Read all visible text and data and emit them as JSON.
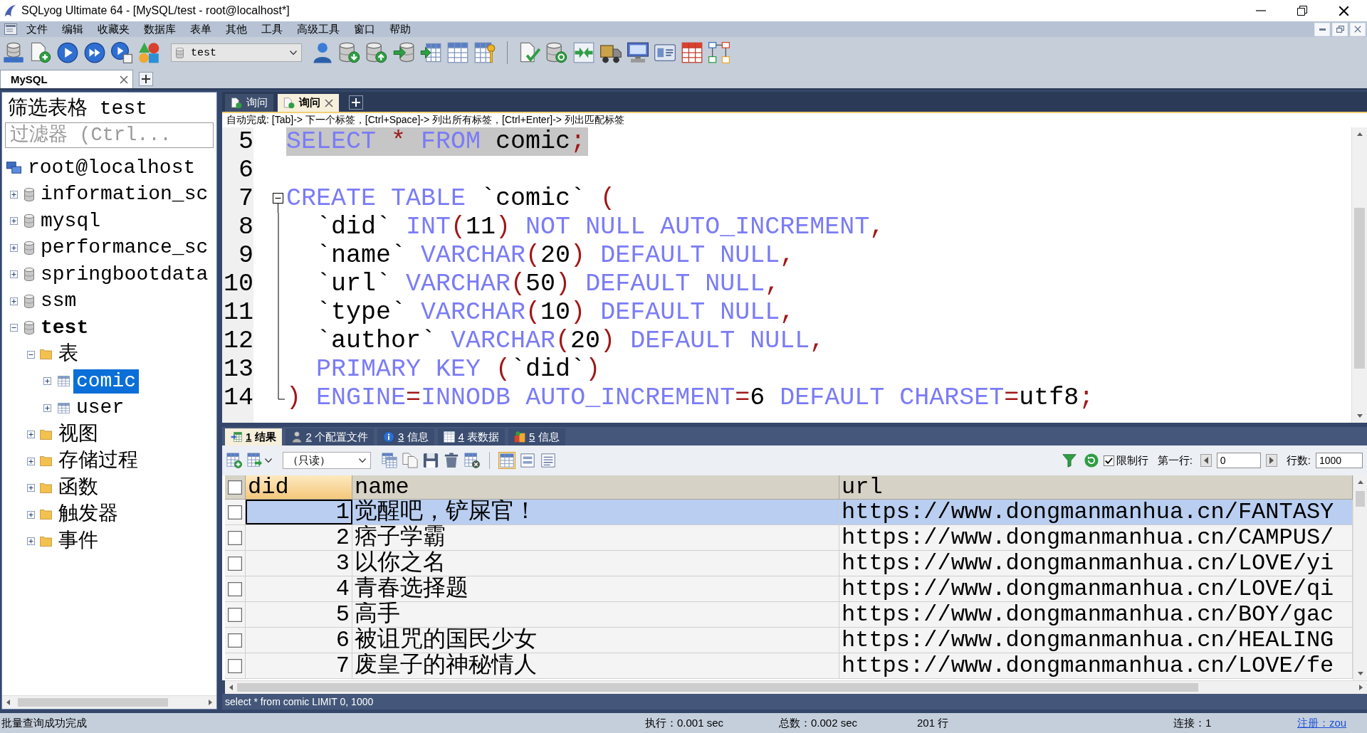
{
  "window": {
    "title": "SQLyog Ultimate 64 - [MySQL/test - root@localhost*]"
  },
  "menu": [
    "文件",
    "编辑",
    "收藏夹",
    "数据库",
    "表单",
    "其他",
    "工具",
    "高级工具",
    "窗口",
    "帮助"
  ],
  "toolbar": {
    "database": "test"
  },
  "connection_tabs": [
    {
      "label": "MySQL",
      "selected": true
    }
  ],
  "object_browser": {
    "title": "筛选表格 test",
    "filter": {
      "placeholder": "过滤器 (Ctrl..."
    },
    "tree": {
      "label": "root@localhost",
      "kind": "server",
      "selected": false,
      "children": [
        {
          "label": "information_sc",
          "kind": "database",
          "expanded": false,
          "current": false,
          "selected": false
        },
        {
          "label": "mysql",
          "kind": "database",
          "expanded": false,
          "current": false,
          "selected": false
        },
        {
          "label": "performance_sc",
          "kind": "database",
          "expanded": false,
          "current": false,
          "selected": false
        },
        {
          "label": "springbootdata",
          "kind": "database",
          "expanded": false,
          "current": false,
          "selected": false
        },
        {
          "label": "ssm",
          "kind": "database",
          "expanded": false,
          "current": false,
          "selected": false
        },
        {
          "label": "test",
          "kind": "database",
          "expanded": true,
          "current": true,
          "selected": false,
          "children": [
            {
              "label": "表",
              "kind": "folder",
              "expanded": true,
              "selected": false,
              "children": [
                {
                  "label": "comic",
                  "kind": "table",
                  "expanded": false,
                  "selected": true
                },
                {
                  "label": "user",
                  "kind": "table",
                  "expanded": false,
                  "selected": false
                }
              ]
            },
            {
              "label": "视图",
              "kind": "folder",
              "expanded": false,
              "selected": false
            },
            {
              "label": "存储过程",
              "kind": "folder",
              "expanded": false,
              "selected": false
            },
            {
              "label": "函数",
              "kind": "folder",
              "expanded": false,
              "selected": false
            },
            {
              "label": "触发器",
              "kind": "folder",
              "expanded": false,
              "selected": false
            },
            {
              "label": "事件",
              "kind": "folder",
              "expanded": false,
              "selected": false
            }
          ]
        }
      ]
    }
  },
  "query_tabs": [
    {
      "label": "询问",
      "selected": false
    },
    {
      "label": "询问",
      "selected": true
    }
  ],
  "autocomplete_hint": "自动完成: [Tab]-> 下一个标签，[Ctrl+Space]-> 列出所有标签，[Ctrl+Enter]-> 列出匹配标签",
  "editor": {
    "lines": [
      {
        "number": "5",
        "text": "SELECT * FROM comic;",
        "selected": true,
        "kind": "plain"
      },
      {
        "number": "6",
        "selected": false,
        "kind": "plain"
      },
      {
        "number": "7",
        "text": "CREATE TABLE `comic` (",
        "selected": false,
        "kind": "opener"
      },
      {
        "number": "8",
        "text": "  `did` INT(11) NOT NULL AUTO_INCREMENT,",
        "selected": false,
        "kind": "inside"
      },
      {
        "number": "9",
        "text": "  `name` VARCHAR(20) DEFAULT NULL,",
        "selected": false,
        "kind": "inside"
      },
      {
        "number": "10",
        "text": "  `url` VARCHAR(50) DEFAULT NULL,",
        "selected": false,
        "kind": "inside"
      },
      {
        "number": "11",
        "text": "  `type` VARCHAR(10) DEFAULT NULL,",
        "selected": false,
        "kind": "inside"
      },
      {
        "number": "12",
        "text": "  `author` VARCHAR(20) DEFAULT NULL,",
        "selected": false,
        "kind": "inside"
      },
      {
        "number": "13",
        "text": "  PRIMARY KEY (`did`)",
        "selected": false,
        "kind": "inside"
      },
      {
        "number": "14",
        "text": ") ENGINE=INNODB AUTO_INCREMENT=6 DEFAULT CHARSET=utf8;",
        "selected": false,
        "kind": "closer"
      }
    ]
  },
  "results_tabs": [
    {
      "number": "1",
      "label": "结果",
      "selected": true
    },
    {
      "number": "2",
      "label": "个配置文件",
      "selected": false
    },
    {
      "number": "3",
      "label": "信息",
      "selected": false
    },
    {
      "number": "4",
      "label": "表数据",
      "selected": false
    },
    {
      "number": "5",
      "label": "信息",
      "selected": false
    }
  ],
  "results_toolbar": {
    "mode": "（只读）",
    "view_modes": [
      {
        "selected": true
      },
      {
        "selected": false
      },
      {
        "selected": false
      }
    ],
    "limit_rows": {
      "label": "限制行",
      "checked": true
    },
    "first_row": {
      "label": "第一行:",
      "value": "0"
    },
    "row_count": {
      "label": "行数:",
      "value": "1000"
    }
  },
  "grid": {
    "header_checked": false,
    "columns": [
      {
        "label": "did",
        "selected": true
      },
      {
        "label": "name",
        "selected": false
      },
      {
        "label": "url",
        "selected": false
      }
    ],
    "rows": [
      {
        "checked": false,
        "selected": true,
        "cells": [
          "1",
          "觉醒吧，铲屎官！",
          "https://www.dongmanmanhua.cn/FANTASY"
        ]
      },
      {
        "checked": false,
        "selected": false,
        "cells": [
          "2",
          "痞子学霸",
          "https://www.dongmanmanhua.cn/CAMPUS/"
        ]
      },
      {
        "checked": false,
        "selected": false,
        "cells": [
          "3",
          "以你之名",
          "https://www.dongmanmanhua.cn/LOVE/yi"
        ]
      },
      {
        "checked": false,
        "selected": false,
        "cells": [
          "4",
          "青春选择题",
          "https://www.dongmanmanhua.cn/LOVE/qi"
        ]
      },
      {
        "checked": false,
        "selected": false,
        "cells": [
          "5",
          "高手",
          "https://www.dongmanmanhua.cn/BOY/gac"
        ]
      },
      {
        "checked": false,
        "selected": false,
        "cells": [
          "6",
          "被诅咒的国民少女",
          "https://www.dongmanmanhua.cn/HEALING"
        ]
      },
      {
        "checked": false,
        "selected": false,
        "cells": [
          "7",
          "废皇子的神秘情人",
          "https://www.dongmanmanhua.cn/LOVE/fe"
        ]
      }
    ]
  },
  "query_line": "select * from comic LIMIT 0, 1000",
  "status_bar": {
    "message": "批量查询成功完成",
    "execution": "执行：0.001 sec",
    "total": "总数：0.002 sec",
    "rows": "201 行",
    "connections": "连接：1",
    "registration": "注册：zou"
  }
}
